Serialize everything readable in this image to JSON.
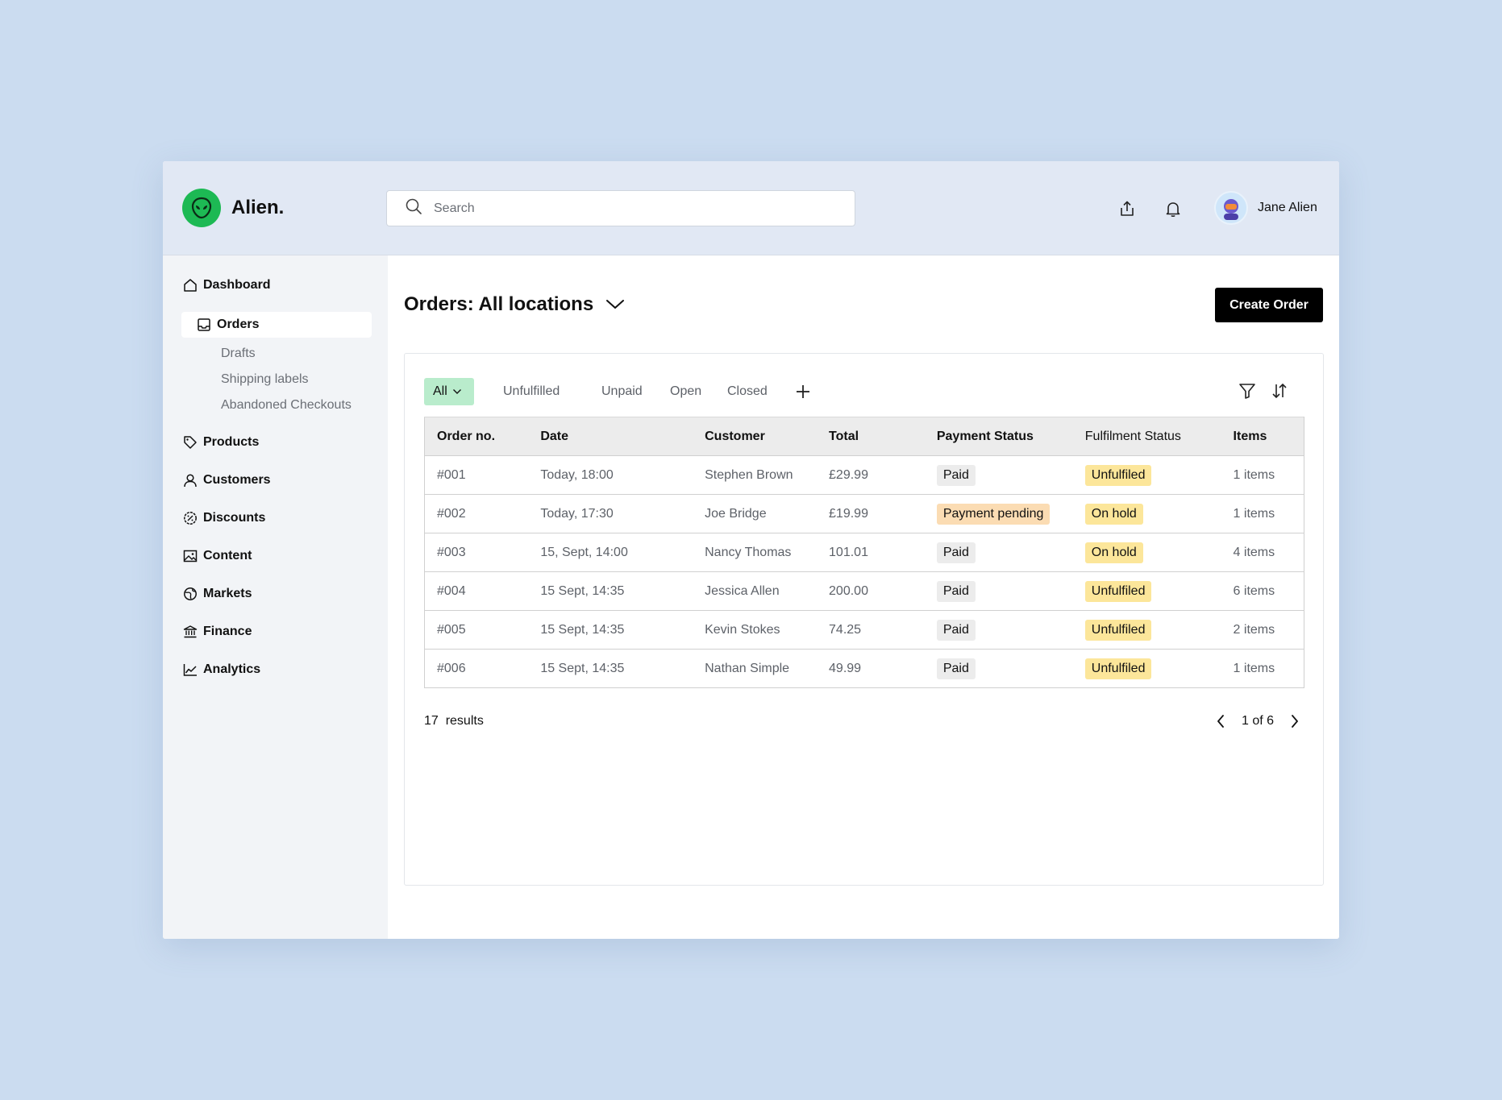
{
  "app": {
    "name": "Alien.",
    "brand_color": "#1db954",
    "logo_icon": "alien-head-icon"
  },
  "search": {
    "placeholder": "Search",
    "value": ""
  },
  "user": {
    "name": "Jane Alien"
  },
  "sidebar": {
    "items": [
      {
        "label": "Dashboard",
        "icon": "home-icon"
      },
      {
        "label": "Orders",
        "icon": "inbox-icon",
        "active": true
      },
      {
        "label": "Products",
        "icon": "tag-icon"
      },
      {
        "label": "Customers",
        "icon": "user-icon"
      },
      {
        "label": "Discounts",
        "icon": "discount-icon"
      },
      {
        "label": "Content",
        "icon": "image-icon"
      },
      {
        "label": "Markets",
        "icon": "globe-icon"
      },
      {
        "label": "Finance",
        "icon": "bank-icon"
      },
      {
        "label": "Analytics",
        "icon": "chart-icon"
      }
    ],
    "orders_sub": [
      "Drafts",
      "Shipping labels",
      "Abandoned Checkouts"
    ]
  },
  "page": {
    "title": "Orders: All locations",
    "create_label": "Create Order"
  },
  "tabs": [
    "All",
    "Unfulfilled",
    "Unpaid",
    "Open",
    "Closed"
  ],
  "table": {
    "headers": [
      "Order no.",
      "Date",
      "Customer",
      "Total",
      "Payment Status",
      "Fulfilment Status",
      "Items"
    ],
    "rows": [
      {
        "order": "#001",
        "date": "Today, 18:00",
        "customer": "Stephen Brown",
        "total": "£29.99",
        "payment": "Paid",
        "fulfilment": "Unfulfiled",
        "items": "1 items"
      },
      {
        "order": "#002",
        "date": "Today, 17:30",
        "customer": "Joe Bridge",
        "total": "£19.99",
        "payment": "Payment pending",
        "fulfilment": "On hold",
        "items": "1 items"
      },
      {
        "order": "#003",
        "date": "15, Sept, 14:00",
        "customer": "Nancy Thomas",
        "total": "101.01",
        "payment": "Paid",
        "fulfilment": "On hold",
        "items": "4 items"
      },
      {
        "order": "#004",
        "date": "15 Sept, 14:35",
        "customer": "Jessica Allen",
        "total": "200.00",
        "payment": "Paid",
        "fulfilment": "Unfulfiled",
        "items": "6 items"
      },
      {
        "order": "#005",
        "date": "15 Sept, 14:35",
        "customer": "Kevin Stokes",
        "total": "74.25",
        "payment": "Paid",
        "fulfilment": "Unfulfiled",
        "items": "2 items"
      },
      {
        "order": "#006",
        "date": "15 Sept, 14:35",
        "customer": "Nathan Simple",
        "total": "49.99",
        "payment": "Paid",
        "fulfilment": "Unfulfiled",
        "items": "1 items"
      }
    ]
  },
  "footer": {
    "results": "17  results",
    "page": "1 of 6"
  },
  "colors": {
    "background": "#cbdcf0",
    "topbar": "#e1e8f4",
    "sidebar": "#f2f4f7",
    "all_tab": "#b9eccc",
    "paid_badge": "#ececec",
    "pending_badge": "#fbdcb3",
    "fulfilment_badge": "#fce69a"
  }
}
